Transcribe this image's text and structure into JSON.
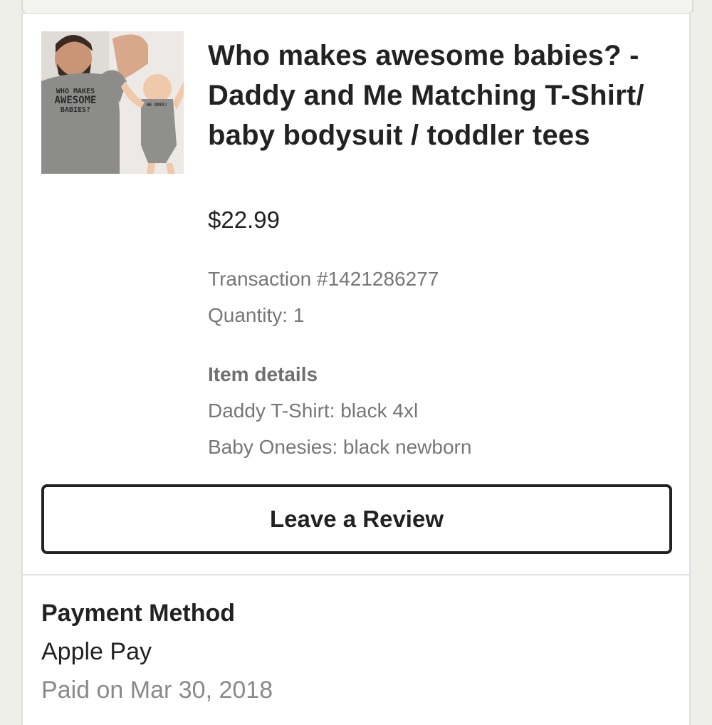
{
  "product": {
    "image_shirt_text": [
      "WHO MAKES",
      "AWESOME",
      "BABIES?"
    ],
    "image_onesie_text": "HE DOES!",
    "title": "Who makes awesome babies? - Daddy and Me Matching T-Shirt/ baby bodysuit / toddler tees",
    "price": "$22.99",
    "transaction": "Transaction #1421286277",
    "quantity": "Quantity: 1",
    "details_heading": "Item details",
    "details": [
      "Daddy T-Shirt: black 4xl",
      "Baby Onesies: black newborn"
    ]
  },
  "review_button": "Leave a Review",
  "payment": {
    "heading": "Payment Method",
    "method": "Apple Pay",
    "paid": "Paid on Mar 30, 2018"
  }
}
